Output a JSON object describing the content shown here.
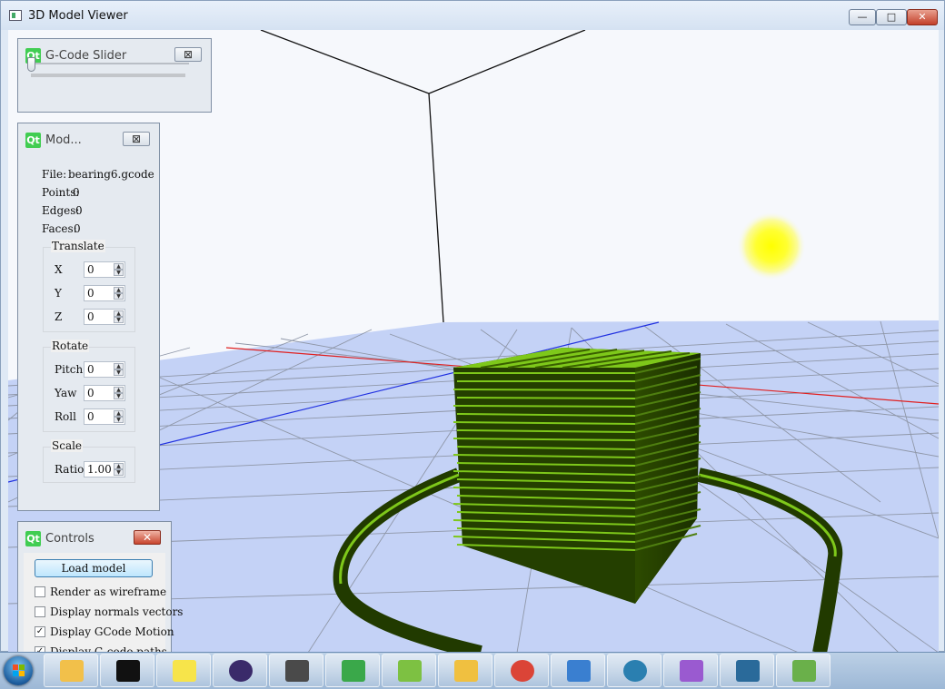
{
  "window": {
    "title": "3D Model Viewer",
    "minimize": "—",
    "maximize": "□",
    "close": "✕"
  },
  "gcode_slider": {
    "title": "G-Code Slider",
    "close": "⊠",
    "value": 0
  },
  "model_panel": {
    "title": "Mod...",
    "close": "⊠",
    "file_label": "File:",
    "file_value": "bearing6.gcode",
    "points_label": "Points:",
    "points_value": "0",
    "edges_label": "Edges:",
    "edges_value": "0",
    "faces_label": "Faces:",
    "faces_value": "0",
    "translate": {
      "title": "Translate",
      "x_label": "X",
      "x": "0",
      "y_label": "Y",
      "y": "0",
      "z_label": "Z",
      "z": "0"
    },
    "rotate": {
      "title": "Rotate",
      "pitch_label": "Pitch",
      "pitch": "0",
      "yaw_label": "Yaw",
      "yaw": "0",
      "roll_label": "Roll",
      "roll": "0"
    },
    "scale": {
      "title": "Scale",
      "ratio_label": "Ratio",
      "ratio": "1.00"
    }
  },
  "controls_panel": {
    "title": "Controls",
    "close": "✕",
    "load_button": "Load model",
    "checkboxes": [
      {
        "label": "Render as wireframe",
        "checked": false
      },
      {
        "label": "Display normals vectors",
        "checked": false
      },
      {
        "label": "Display GCode Motion",
        "checked": true
      },
      {
        "label": "Display G-code paths",
        "checked": true
      }
    ]
  },
  "taskbar": {
    "items": [
      {
        "name": "file-explorer-icon"
      },
      {
        "name": "command-prompt-icon"
      },
      {
        "name": "sticky-notes-icon"
      },
      {
        "name": "eclipse-icon"
      },
      {
        "name": "sublime-text-icon"
      },
      {
        "name": "qt-creator-icon"
      },
      {
        "name": "android-studio-icon"
      },
      {
        "name": "outlook-icon"
      },
      {
        "name": "chrome-icon"
      },
      {
        "name": "control-panel-icon"
      },
      {
        "name": "network-app-icon"
      },
      {
        "name": "paint-icon"
      },
      {
        "name": "viewer-app-icon"
      },
      {
        "name": "notepad-plus-plus-icon"
      }
    ]
  },
  "colors": {
    "model_green": "#7ec81a",
    "model_dark": "#213a00",
    "floor": "#bfd0f5",
    "light": "#ffff00",
    "x_axis": "#e02020",
    "z_axis": "#2030e0"
  }
}
